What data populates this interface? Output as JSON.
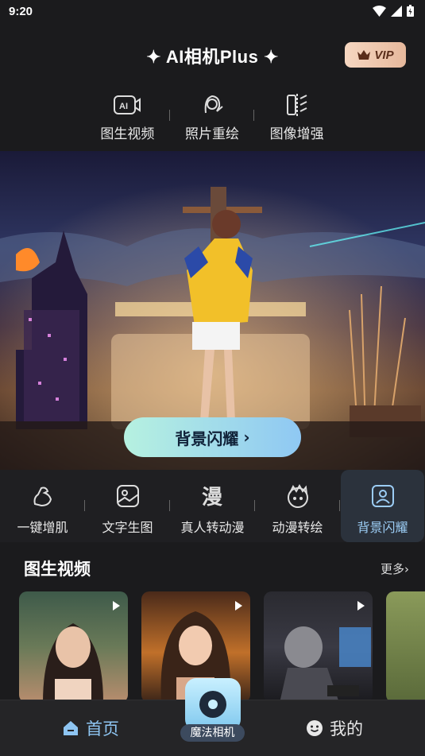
{
  "status": {
    "time": "9:20"
  },
  "header": {
    "title": "AI相机Plus",
    "vip_label": "VIP"
  },
  "top_tools": [
    {
      "label": "图生视频",
      "icon": "ai-video-icon"
    },
    {
      "label": "照片重绘",
      "icon": "portrait-brush-icon"
    },
    {
      "label": "图像增强",
      "icon": "image-enhance-icon"
    }
  ],
  "banner": {
    "button_label": "背景闪耀"
  },
  "feature_tabs": [
    {
      "label": "一键增肌",
      "icon": "muscle-icon"
    },
    {
      "label": "文字生图",
      "icon": "text-to-image-icon"
    },
    {
      "label": "真人转动漫",
      "icon": "anime-icon"
    },
    {
      "label": "动漫转绘",
      "icon": "anime-redraw-icon"
    },
    {
      "label": "背景闪耀",
      "icon": "background-shine-icon",
      "active": true
    }
  ],
  "section": {
    "title": "图生视频",
    "more_label": "更多"
  },
  "bottom_nav": {
    "home_label": "首页",
    "camera_label": "魔法相机",
    "me_label": "我的"
  },
  "colors": {
    "accent": "#8ec5f2",
    "vip_bg": "#f6d7c1",
    "banner_button": "#b6f1e0",
    "background": "#1b1b1d"
  }
}
